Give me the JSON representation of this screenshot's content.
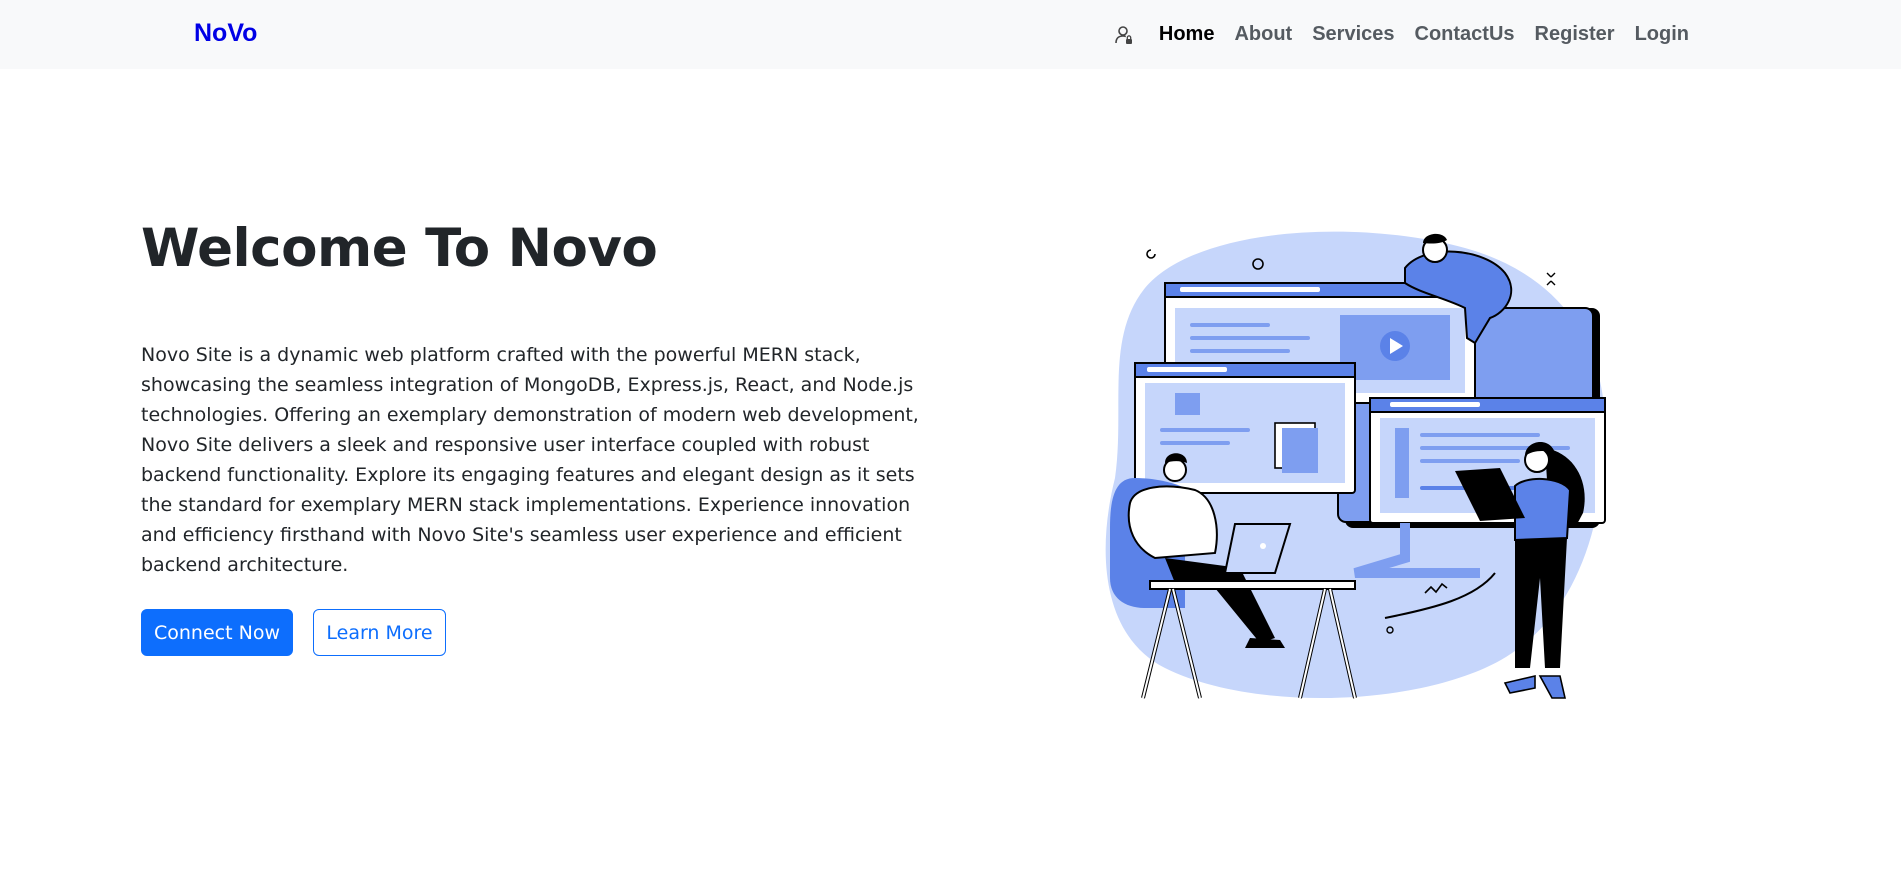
{
  "navbar": {
    "brand": "NoVo",
    "user_icon": "user-lock-icon",
    "links": [
      {
        "label": "Home",
        "active": true
      },
      {
        "label": "About",
        "active": false
      },
      {
        "label": "Services",
        "active": false
      },
      {
        "label": "ContactUs",
        "active": false
      },
      {
        "label": "Register",
        "active": false
      },
      {
        "label": "Login",
        "active": false
      }
    ]
  },
  "hero": {
    "title": "Welcome To Novo",
    "description": "Novo Site is a dynamic web platform crafted with the powerful MERN stack, showcasing the seamless integration of MongoDB, Express.js, React, and Node.js technologies. Offering an exemplary demonstration of modern web development, Novo Site delivers a sleek and responsive user interface coupled with robust backend functionality. Explore its engaging features and elegant design as it sets the standard for exemplary MERN stack implementations. Experience innovation and efficiency firsthand with Novo Site's seamless user experience and efficient backend architecture.",
    "primary_button": "Connect Now",
    "secondary_button": "Learn More",
    "illustration_icon": "web-development-team-illustration"
  },
  "colors": {
    "brand": "#0000e6",
    "primary": "#0d6efd",
    "navbar_bg": "#f8f9fa",
    "illustration_blue": "#5b82e8",
    "illustration_light": "#c6d6fb"
  }
}
